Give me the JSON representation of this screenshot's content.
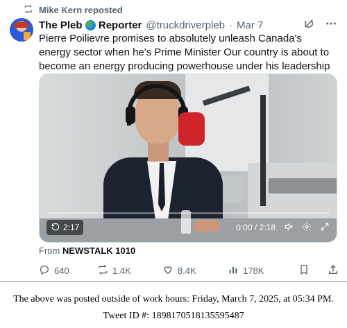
{
  "repost": {
    "text": "Mike Kern reposted",
    "icon": "repost-icon"
  },
  "tweet": {
    "display_name_part1": "The Pleb",
    "display_name_part2": "Reporter",
    "handle": "@truckdriverpleb",
    "separator": "·",
    "date": "Mar 7",
    "text": "Pierre Poilievre promises to absolutely unleash Canada's energy sector when he's Prime Minister Our country is about to become an energy producing powerhouse under his leadership"
  },
  "video": {
    "badge_time": "2:17",
    "time": "0:00 / 2:18",
    "progress": 0,
    "colors": {
      "mic_flag": "#d0242b"
    }
  },
  "source": {
    "prefix": "From",
    "name": "NEWSTALK 1010"
  },
  "actions": {
    "replies": "640",
    "reposts": "1.4K",
    "likes": "8.4K",
    "views": "178K"
  },
  "footer": {
    "line1": "The above was posted outside of work hours: Friday, March 7, 2025, at 05:34 PM.",
    "line2": "Tweet ID #: 1898170518135595487"
  }
}
